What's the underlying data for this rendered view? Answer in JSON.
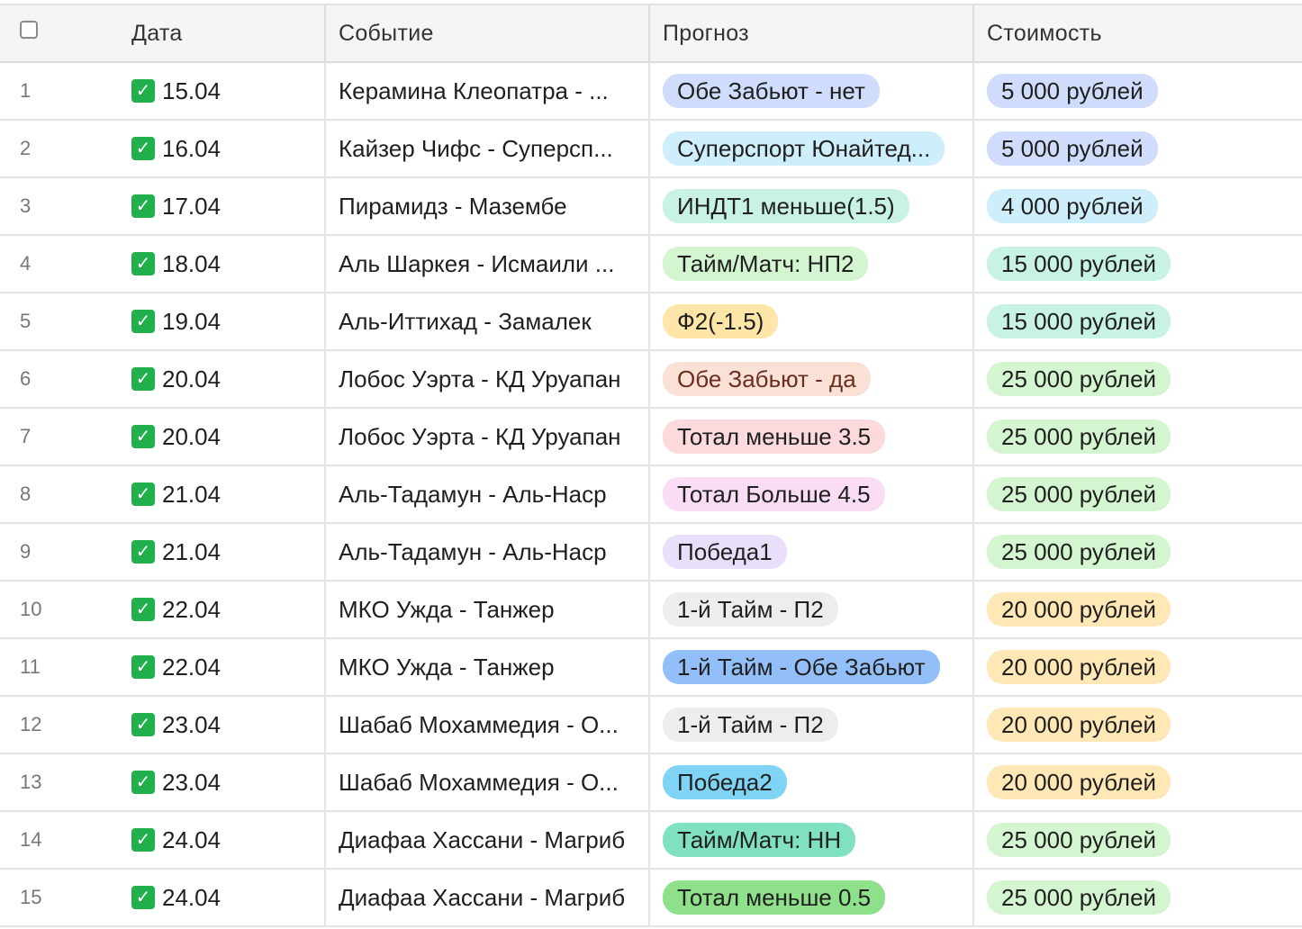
{
  "headers": {
    "date": "Дата",
    "event": "Событие",
    "prediction": "Прогноз",
    "cost": "Стоимость"
  },
  "rows": [
    {
      "num": "1",
      "date": "15.04",
      "event": "Керамина Клеопатра - ...",
      "prediction": "Обе Забьют - нет",
      "prediction_bg": "#cfdcfb",
      "cost": "5 000 рублей",
      "cost_bg": "#cfdcfb"
    },
    {
      "num": "2",
      "date": "16.04",
      "event": "Кайзер Чифс - Суперсп...",
      "prediction": "Суперспорт Юнайтед...",
      "prediction_bg": "#cdeefa",
      "cost": "5 000 рублей",
      "cost_bg": "#cfdcfb"
    },
    {
      "num": "3",
      "date": "17.04",
      "event": "Пирамидз - Мазембе",
      "prediction": "ИНДТ1 меньше(1.5)",
      "prediction_bg": "#c8f2e6",
      "cost": "4 000 рублей",
      "cost_bg": "#cdeefa"
    },
    {
      "num": "4",
      "date": "18.04",
      "event": "Аль Шаркея - Исмаили ...",
      "prediction": "Тайм/Матч: НП2",
      "prediction_bg": "#d3f5cf",
      "cost": "15 000 рублей",
      "cost_bg": "#c8f2e6"
    },
    {
      "num": "5",
      "date": "19.04",
      "event": "Аль-Иттихад - Замалек",
      "prediction": "Ф2(-1.5)",
      "prediction_bg": "#ffe5a8",
      "cost": "15 000 рублей",
      "cost_bg": "#c8f2e6"
    },
    {
      "num": "6",
      "date": "20.04",
      "event": "Лобос Уэрта - КД Уруапан",
      "prediction": "Обе Забьют - да",
      "prediction_bg": "#fbe0d6",
      "prediction_color": "#6b2f20",
      "cost": "25 000 рублей",
      "cost_bg": "#d3f5cf"
    },
    {
      "num": "7",
      "date": "20.04",
      "event": "Лобос Уэрта - КД Уруапан",
      "prediction": "Тотал меньше 3.5",
      "prediction_bg": "#fcd9dd",
      "cost": "25 000 рублей",
      "cost_bg": "#d3f5cf"
    },
    {
      "num": "8",
      "date": "21.04",
      "event": "Аль-Тадамун - Аль-Наср",
      "prediction": "Тотал Больше 4.5",
      "prediction_bg": "#fadcf4",
      "cost": "25 000 рублей",
      "cost_bg": "#d3f5cf"
    },
    {
      "num": "9",
      "date": "21.04",
      "event": "Аль-Тадамун - Аль-Наср",
      "prediction": "Победа1",
      "prediction_bg": "#eadffb",
      "cost": "25 000 рублей",
      "cost_bg": "#d3f5cf"
    },
    {
      "num": "10",
      "date": "22.04",
      "event": "МКО Ужда - Танжер",
      "prediction": "1-й Тайм - П2",
      "prediction_bg": "#ededed",
      "cost": "20 000 рублей",
      "cost_bg": "#ffe8b6"
    },
    {
      "num": "11",
      "date": "22.04",
      "event": "МКО Ужда - Танжер",
      "prediction": "1-й Тайм - Обе Забьют",
      "prediction_bg": "#93bff8",
      "cost": "20 000 рублей",
      "cost_bg": "#ffe8b6"
    },
    {
      "num": "12",
      "date": "23.04",
      "event": "Шабаб Мохаммедия - О...",
      "prediction": "1-й Тайм - П2",
      "prediction_bg": "#ededed",
      "cost": "20 000 рублей",
      "cost_bg": "#ffe8b6"
    },
    {
      "num": "13",
      "date": "23.04",
      "event": "Шабаб Мохаммедия - О...",
      "prediction": "Победа2",
      "prediction_bg": "#7fd3f4",
      "cost": "20 000 рублей",
      "cost_bg": "#ffe8b6"
    },
    {
      "num": "14",
      "date": "24.04",
      "event": "Диафаа Хассани - Магриб",
      "prediction": "Тайм/Матч: НН",
      "prediction_bg": "#7fe0c2",
      "cost": "25 000 рублей",
      "cost_bg": "#d3f5cf"
    },
    {
      "num": "15",
      "date": "24.04",
      "event": "Диафаа Хассани - Магриб",
      "prediction": "Тотал меньше 0.5",
      "prediction_bg": "#8fe08a",
      "cost": "25 000 рублей",
      "cost_bg": "#d3f5cf"
    }
  ]
}
